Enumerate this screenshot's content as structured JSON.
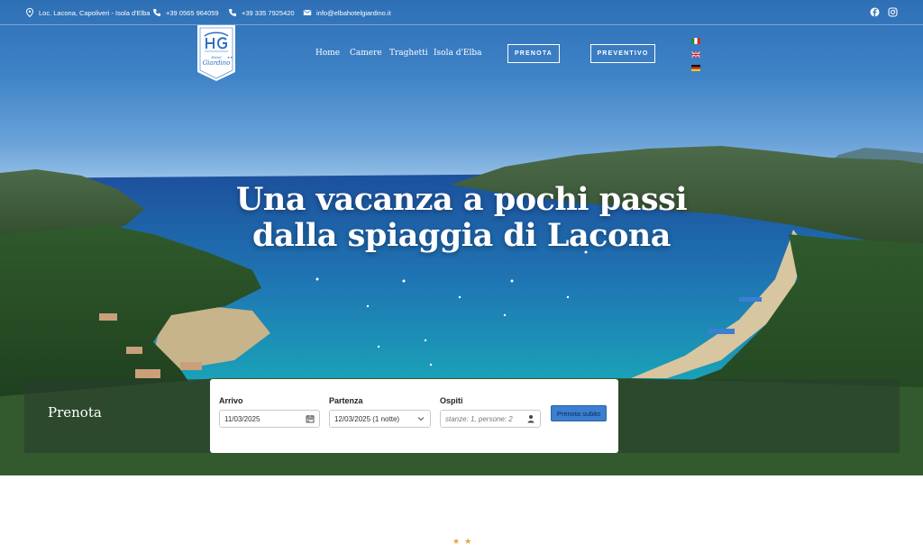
{
  "topbar": {
    "address": "Loc. Lacona, Capoliveri - Isola d'Elba",
    "phone1": "+39 0565 964059",
    "phone2": "+39 335 7925420",
    "email": "info@elbahotelgiardino.it",
    "icons": [
      "map-pin-icon",
      "phone-icon",
      "phone-icon",
      "envelope-icon",
      "facebook-icon",
      "instagram-icon"
    ]
  },
  "logo": {
    "subtitle": "Hotel Giardino",
    "stars": "★★"
  },
  "nav": {
    "items": [
      "Home",
      "Camere",
      "Traghetti",
      "Isola d'Elba"
    ],
    "prenota_label": "PRENOTA",
    "preventivo_label": "PREVENTIVO",
    "languages": [
      "it",
      "en",
      "de"
    ]
  },
  "hero": {
    "headline_line1": "Una vacanza a pochi passi",
    "headline_line2": "dalla spiaggia di Lacona"
  },
  "booking": {
    "title": "Prenota",
    "arrivo_label": "Arrivo",
    "arrivo_value": "11/03/2025",
    "partenza_label": "Partenza",
    "partenza_value": "12/03/2025 (1 notte)",
    "ospiti_label": "Ospiti",
    "ospiti_placeholder": "stanze: 1, persone: 2",
    "submit_label": "Prenota subito"
  },
  "footer_stars": "★★",
  "colors": {
    "accent": "#3a7fd0",
    "star": "#e6a23c",
    "sea": "#1aa3b8"
  }
}
